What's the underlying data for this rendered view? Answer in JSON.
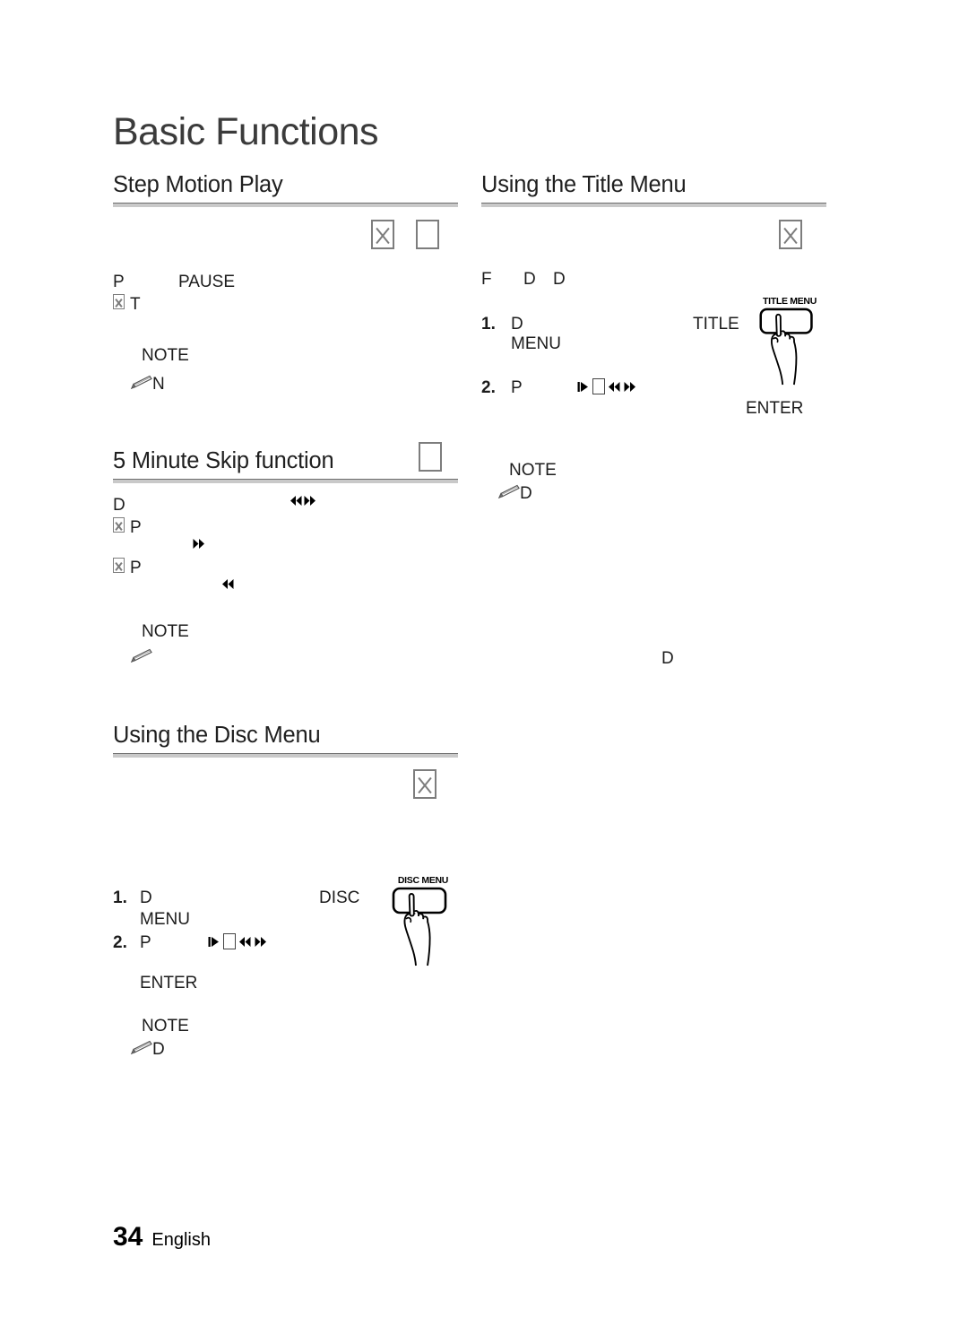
{
  "page": {
    "chapter_title": "Basic Functions",
    "footer": {
      "page_number": "34",
      "language": "English"
    }
  },
  "sections": [
    {
      "id": "step-motion-play",
      "title": "Step Motion Play",
      "column": "left",
      "disc_type_glyphs": [
        "tofu-x",
        "tofu-empty"
      ],
      "body_fragments": [
        {
          "text": "P"
        },
        {
          "text": "PAUSE"
        },
        {
          "text": "T"
        }
      ],
      "note": {
        "label": "NOTE",
        "icon": "pencil-icon",
        "fragment": "N"
      }
    },
    {
      "id": "five-minute-skip",
      "title": "5 Minute Skip function",
      "column": "left",
      "disc_type_glyphs": [
        "tofu-empty"
      ],
      "body_fragments": [
        {
          "text": "D"
        },
        {
          "text": "P"
        },
        {
          "text": "P"
        }
      ],
      "arrow_glyphs": [
        "rewind-fastforward-cluster",
        "fast-forward",
        "rewind"
      ],
      "note": {
        "label": "NOTE",
        "icon": "pencil-icon",
        "fragment": ""
      }
    },
    {
      "id": "using-the-disc-menu",
      "title": "Using the Disc Menu",
      "column": "left",
      "disc_type_glyphs": [
        "tofu-x"
      ],
      "steps": [
        {
          "number": "1.",
          "fragment": "D",
          "button_ref": "DISC",
          "continuation": "MENU"
        },
        {
          "number": "2.",
          "fragment": "P",
          "arrow_glyphs": [
            "step-forward",
            "tofu-empty",
            "rewind",
            "fast-forward"
          ],
          "continuation": "ENTER"
        }
      ],
      "button_illustration": {
        "caption": "DISC MENU",
        "icon": "hand-pressing-button-icon"
      },
      "note": {
        "label": "NOTE",
        "icon": "pencil-icon",
        "fragment": "D"
      }
    },
    {
      "id": "using-the-title-menu",
      "title": "Using the Title Menu",
      "column": "right",
      "disc_type_glyphs": [
        "tofu-x"
      ],
      "intro_fragments": [
        "F",
        "D",
        "D"
      ],
      "steps": [
        {
          "number": "1.",
          "fragment": "D",
          "button_ref": "TITLE",
          "continuation": "MENU"
        },
        {
          "number": "2.",
          "fragment": "P",
          "arrow_glyphs": [
            "step-forward",
            "tofu-empty",
            "rewind",
            "fast-forward"
          ]
        }
      ],
      "button_illustration": {
        "caption": "TITLE MENU",
        "icon": "hand-pressing-button-icon",
        "sub_label": "ENTER"
      },
      "note": {
        "label": "NOTE",
        "icon": "pencil-icon",
        "fragment": "D"
      },
      "trailing_fragment": "D"
    }
  ]
}
